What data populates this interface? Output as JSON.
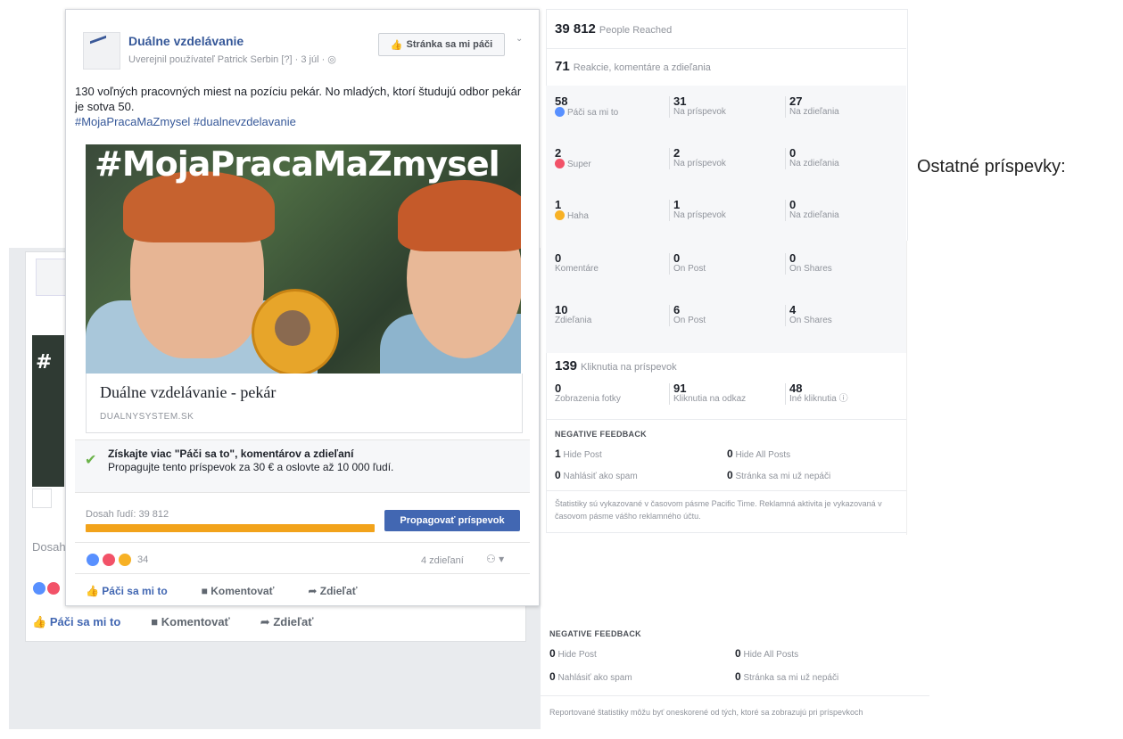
{
  "colors": {
    "facebook_blue": "#4267b2",
    "link_blue": "#365899",
    "orange": "#f2a31b",
    "green": "#6bb34a"
  },
  "post": {
    "page_name": "Duálne vzdelávanie",
    "published_by": "Uverejnil používateľ Patrick Serbin [?] · 3 júl · ◎",
    "like_page_button": "Stránka sa mi páči",
    "text": "130 voľných pracovných miest na pozíciu pekár. No mladých, ktorí študujú odbor pekár je sotva 50.",
    "hashtags": "#MojaPracaMaZmysel #dualnevzdelavanie",
    "image_headline": "#MojaPracaMaZmysel",
    "link_title": "Duálne vzdelávanie - pekár",
    "link_domain": "DUALNYSYSTEM.SK",
    "promo_title": "Získajte viac \"Páči sa to\", komentárov a zdieľaní",
    "promo_sub": "Propagujte tento príspevok za 30 € a oslovte až 10 000 ľudí.",
    "reach_label": "Dosah ľudí: 39 812",
    "boost_button": "Propagovať príspevok",
    "reaction_count": "34",
    "shares_count": "4 zdieľaní",
    "like_action": "Páči sa mi to",
    "comment_action": "Komentovať",
    "share_action": "Zdieľať"
  },
  "back_post": {
    "image_fragment": "#",
    "reach_fragment": "Dosah",
    "like_action": "Páči sa mi to",
    "comment_action": "Komentovať",
    "share_action": "Zdieľať"
  },
  "insights": {
    "people_reached_value": "39 812",
    "people_reached_label": "People Reached",
    "reactions_value": "71",
    "reactions_label": "Reakcie, komentáre a zdieľania",
    "rows": [
      {
        "c1": "58",
        "c1l": "Páči sa mi to",
        "c2": "31",
        "c2l": "Na príspevok",
        "c3": "27",
        "c3l": "Na zdieľania"
      },
      {
        "c1": "2",
        "c1l": "Super",
        "c2": "2",
        "c2l": "Na príspevok",
        "c3": "0",
        "c3l": "Na zdieľania"
      },
      {
        "c1": "1",
        "c1l": "Haha",
        "c2": "1",
        "c2l": "Na príspevok",
        "c3": "0",
        "c3l": "Na zdieľania"
      },
      {
        "c1": "0",
        "c1l": "Komentáre",
        "c2": "0",
        "c2l": "On Post",
        "c3": "0",
        "c3l": "On Shares"
      },
      {
        "c1": "10",
        "c1l": "Zdieľania",
        "c2": "6",
        "c2l": "On Post",
        "c3": "4",
        "c3l": "On Shares"
      }
    ],
    "clicks_value": "139",
    "clicks_label": "Kliknutia na príspevok",
    "click_cells": [
      {
        "v": "0",
        "l": "Zobrazenia fotky"
      },
      {
        "v": "91",
        "l": "Kliknutia na odkaz"
      },
      {
        "v": "48",
        "l": "Iné kliknutia ⓘ"
      }
    ],
    "negative_title": "NEGATIVE FEEDBACK",
    "negative": [
      {
        "v": "1",
        "l": "Hide Post"
      },
      {
        "v": "0",
        "l": "Hide All Posts"
      },
      {
        "v": "0",
        "l": "Nahlásiť ako spam"
      },
      {
        "v": "0",
        "l": "Stránka sa mi už nepáči"
      }
    ],
    "note": "Štatistiky sú vykazované v časovom pásme Pacific Time. Reklamná aktivita je vykazovaná v časovom pásme vášho reklamného účtu."
  },
  "lower_panel": {
    "negative_title": "NEGATIVE FEEDBACK",
    "negative": [
      {
        "v": "0",
        "l": "Hide Post"
      },
      {
        "v": "0",
        "l": "Hide All Posts"
      },
      {
        "v": "0",
        "l": "Nahlásiť ako spam"
      },
      {
        "v": "0",
        "l": "Stránka sa mi už nepáči"
      }
    ],
    "note": "Reportované štatistiky môžu byť oneskorené od tých, ktoré sa zobrazujú pri príspevkoch"
  },
  "side_caption": "Ostatné príspevky:"
}
